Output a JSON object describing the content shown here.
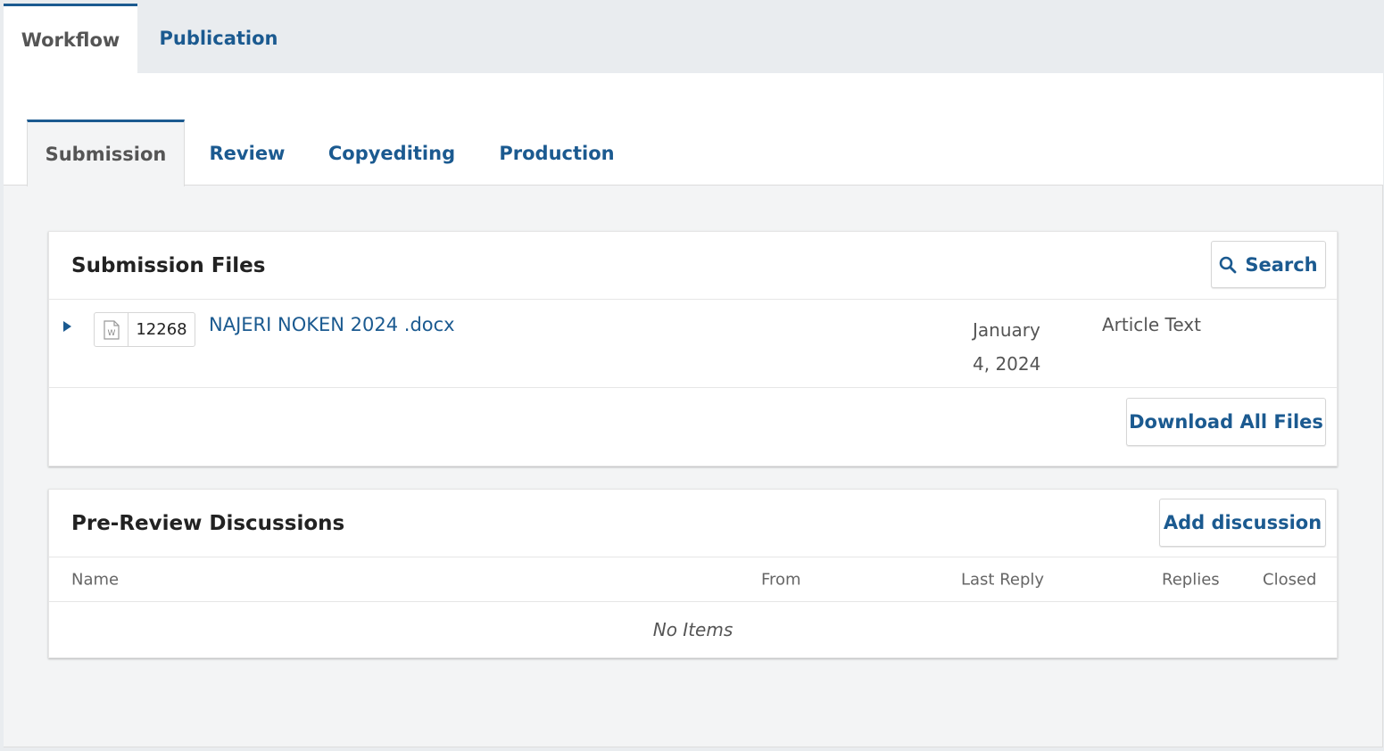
{
  "top_tabs": [
    {
      "label": "Workflow",
      "active": true
    },
    {
      "label": "Publication",
      "active": false
    }
  ],
  "stage_tabs": [
    {
      "label": "Submission",
      "active": true
    },
    {
      "label": "Review",
      "active": false
    },
    {
      "label": "Copyediting",
      "active": false
    },
    {
      "label": "Production",
      "active": false
    }
  ],
  "submission_files": {
    "title": "Submission Files",
    "search_label": "Search",
    "files": [
      {
        "id": "12268",
        "name": "NAJERI NOKEN 2024 .docx",
        "date_line1": "January",
        "date_line2": "4, 2024",
        "type": "Article Text",
        "icon": "word-document-icon"
      }
    ],
    "download_all_label": "Download All Files"
  },
  "discussions": {
    "title": "Pre-Review Discussions",
    "add_label": "Add discussion",
    "columns": [
      "Name",
      "From",
      "Last Reply",
      "Replies",
      "Closed"
    ],
    "empty_text": "No Items"
  },
  "colors": {
    "accent": "#1b5a90",
    "panel_bg": "#f3f4f5",
    "page_bg": "#e9ecef"
  }
}
